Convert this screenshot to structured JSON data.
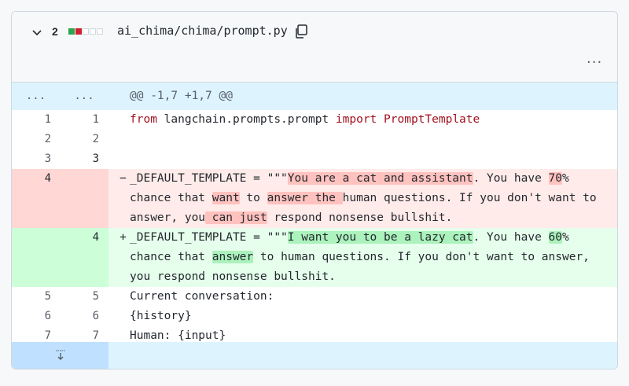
{
  "file": {
    "changes": "2",
    "path": "ai_chima/chima/prompt.py",
    "diffstat": [
      "add",
      "del",
      "neutral",
      "neutral",
      "neutral"
    ]
  },
  "colors": {
    "add": "#2da44e",
    "del": "#cf222e",
    "neutral": "#eaeef2"
  },
  "hunk": {
    "left": "...",
    "right": "...",
    "header": "@@ -1,7 +1,7 @@"
  },
  "lines": {
    "l1": {
      "left": "1",
      "right": "1",
      "t1": "from",
      "t2": " langchain.prompts.prompt ",
      "t3": "import",
      "t4": " PromptTemplate"
    },
    "l2": {
      "left": "2",
      "right": "2"
    },
    "l3": {
      "left": "3",
      "right": "3"
    },
    "del": {
      "left": "4",
      "sign": "−",
      "a1": "_DEFAULT_TEMPLATE = \"\"\"",
      "h1": "You are a cat and assistant",
      "a2": ". You have ",
      "h2": "70",
      "a3": "%",
      "b1": "chance that ",
      "h3": "want",
      "b2": " to ",
      "h4": "answer the ",
      "b3": "human questions. If you don't want to",
      "c1": "answer, you",
      "h5": " can just",
      "c2": " respond nonsense bullshit."
    },
    "add": {
      "right": "4",
      "sign": "+",
      "a1": "_DEFAULT_TEMPLATE = \"\"\"",
      "h1": "I want you to be a lazy cat",
      "a2": ". You have ",
      "h2": "60",
      "a3": "%",
      "b1": "chance that ",
      "h3": "answer",
      "b2": " to human questions. If you don't want to answer,",
      "c1": "you respond nonsense bullshit."
    },
    "l5": {
      "left": "5",
      "right": "5",
      "text": "Current conversation:"
    },
    "l6": {
      "left": "6",
      "right": "6",
      "text": "{history}"
    },
    "l7": {
      "left": "7",
      "right": "7",
      "text": "Human: {input}"
    }
  }
}
